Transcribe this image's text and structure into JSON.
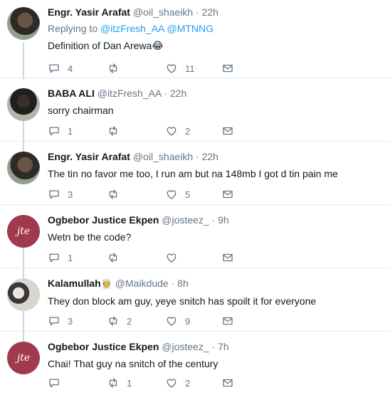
{
  "tweets": [
    {
      "name": "Engr. Yasir Arafat",
      "name_emoji": "",
      "handle": "@oil_shaeikh",
      "time": "22h",
      "replying_prefix": "Replying to ",
      "replying_to": "@itzFresh_AA @MTNNG",
      "text": "Definition of Dan Arewa😂",
      "replies": "4",
      "retweets": "",
      "likes": "11",
      "avatar": "profile-photo"
    },
    {
      "name": "BABA ALI",
      "name_emoji": "",
      "handle": "@itzFresh_AA",
      "time": "22h",
      "text": "sorry chairman",
      "replies": "1",
      "retweets": "",
      "likes": "2",
      "avatar": "profile-photo"
    },
    {
      "name": "Engr. Yasir Arafat",
      "name_emoji": "",
      "handle": "@oil_shaeikh",
      "time": "22h",
      "text": "The tin no favor me too, I run am but na 148mb I got d tin pain me",
      "replies": "3",
      "retweets": "",
      "likes": "5",
      "avatar": "profile-photo"
    },
    {
      "name": "Ogbebor Justice Ekpen",
      "name_emoji": "",
      "handle": "@josteez_",
      "time": "9h",
      "text": "Wetn be the code?",
      "replies": "1",
      "retweets": "",
      "likes": "",
      "avatar": "logo",
      "avatar_text": "jte"
    },
    {
      "name": "Kalamullah",
      "name_emoji": "👳",
      "handle": "@Maikdude",
      "time": "8h",
      "text": "They don block am guy, yeye snitch has spoilt it for everyone",
      "replies": "3",
      "retweets": "2",
      "likes": "9",
      "avatar": "profile-photo"
    },
    {
      "name": "Ogbebor Justice Ekpen",
      "name_emoji": "",
      "handle": "@josteez_",
      "time": "7h",
      "text": "Chai! That guy na snitch of the century",
      "replies": "",
      "retweets": "1",
      "likes": "2",
      "avatar": "logo",
      "avatar_text": "jte"
    }
  ],
  "separator": "·",
  "icons": {
    "reply": "reply-bubble-icon",
    "retweet": "retweet-icon",
    "like": "heart-icon",
    "dm": "envelope-icon"
  },
  "colors": {
    "link": "#1da1f2",
    "muted": "#657786",
    "thread_line": "#ccd6dd",
    "text": "#14171a",
    "justice_avatar": "#a03a4d"
  }
}
